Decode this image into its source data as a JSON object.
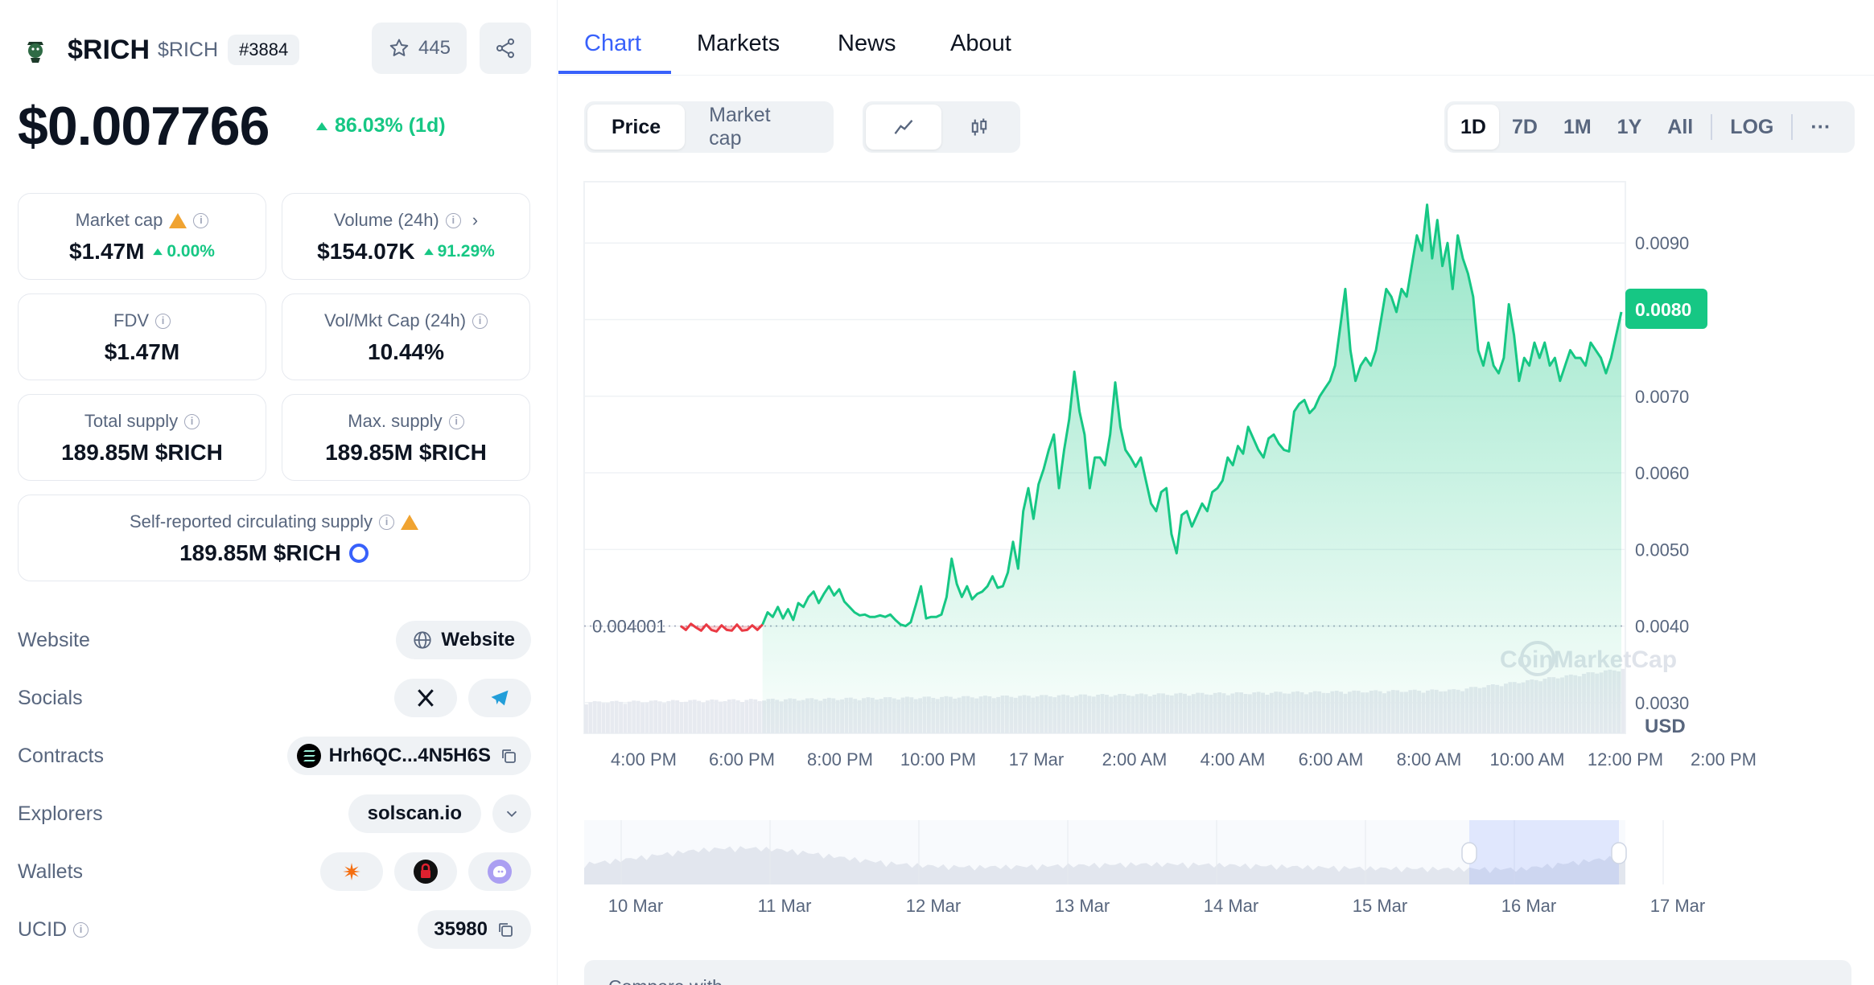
{
  "coin": {
    "name": "$RICH",
    "symbol": "$RICH",
    "rank": "#3884",
    "watchlist_count": "445",
    "price": "$0.007766",
    "change_1d": "86.03% (1d)"
  },
  "stats": {
    "market_cap": {
      "label": "Market cap",
      "value": "$1.47M",
      "change": "0.00%"
    },
    "volume": {
      "label": "Volume (24h)",
      "value": "$154.07K",
      "change": "91.29%"
    },
    "fdv": {
      "label": "FDV",
      "value": "$1.47M"
    },
    "vol_mkt": {
      "label": "Vol/Mkt Cap (24h)",
      "value": "10.44%"
    },
    "total_supply": {
      "label": "Total supply",
      "value": "189.85M $RICH"
    },
    "max_supply": {
      "label": "Max. supply",
      "value": "189.85M $RICH"
    },
    "circ_supply": {
      "label": "Self-reported circulating supply",
      "value": "189.85M $RICH"
    }
  },
  "links": {
    "website_label": "Website",
    "website_btn": "Website",
    "socials_label": "Socials",
    "contracts_label": "Contracts",
    "contract": "Hrh6QC...4N5H6S",
    "explorers_label": "Explorers",
    "explorer": "solscan.io",
    "wallets_label": "Wallets",
    "ucid_label": "UCID",
    "ucid": "35980"
  },
  "tabs": [
    "Chart",
    "Markets",
    "News",
    "About"
  ],
  "chart_toggle": {
    "price": "Price",
    "market_cap": "Market cap"
  },
  "ranges": [
    "1D",
    "7D",
    "1M",
    "1Y",
    "All",
    "LOG"
  ],
  "more_label": "···",
  "compare_label": "Compare with",
  "watermark": "CoinMarketCap",
  "colors": {
    "up": "#16c784",
    "down": "#ea3943",
    "accent": "#3861fb"
  },
  "chart_data": {
    "type": "line",
    "currency": "USD",
    "current_price_label": "0.0080",
    "open_price_label": "0.004001",
    "ylim": [
      0.0026,
      0.0098
    ],
    "y_ticks": [
      "0.0090",
      "0.0080",
      "0.0070",
      "0.0060",
      "0.0050",
      "0.0040",
      "0.0030"
    ],
    "y_tick_values": [
      0.009,
      0.008,
      0.007,
      0.006,
      0.005,
      0.004,
      0.003
    ],
    "x_ticks": [
      "4:00 PM",
      "6:00 PM",
      "8:00 PM",
      "10:00 PM",
      "17 Mar",
      "2:00 AM",
      "4:00 AM",
      "6:00 AM",
      "8:00 AM",
      "10:00 AM",
      "12:00 PM",
      "2:00 PM"
    ],
    "nav_ticks": [
      "10 Mar",
      "11 Mar",
      "12 Mar",
      "13 Mar",
      "14 Mar",
      "15 Mar",
      "16 Mar",
      "17 Mar"
    ],
    "series": [
      {
        "values": [
          0.004,
          0.00395,
          0.00403,
          0.00398,
          0.00394,
          0.00402,
          0.00395,
          0.00393,
          0.00401,
          0.00395,
          0.00394,
          0.00402,
          0.00394,
          0.00395,
          0.00401,
          0.00395,
          0.00402,
          0.00418,
          0.00412,
          0.00425,
          0.0041,
          0.00422,
          0.00408,
          0.0043,
          0.00425,
          0.00438,
          0.00445,
          0.0043,
          0.00442,
          0.00452,
          0.0044,
          0.00448,
          0.00432,
          0.00425,
          0.00418,
          0.00414,
          0.00415,
          0.00412,
          0.00412,
          0.00414,
          0.00412,
          0.00415,
          0.00408,
          0.00402,
          0.004,
          0.00405,
          0.00428,
          0.00452,
          0.0041,
          0.00412,
          0.00412,
          0.00415,
          0.00438,
          0.00488,
          0.00455,
          0.00438,
          0.00452,
          0.00435,
          0.00442,
          0.00445,
          0.00452,
          0.00465,
          0.0045,
          0.00452,
          0.0047,
          0.0051,
          0.00475,
          0.0055,
          0.0058,
          0.0054,
          0.00585,
          0.00605,
          0.0063,
          0.0065,
          0.0058,
          0.0063,
          0.0067,
          0.00732,
          0.0068,
          0.0065,
          0.0058,
          0.0062,
          0.0062,
          0.0061,
          0.0065,
          0.00718,
          0.0066,
          0.0063,
          0.0062,
          0.00608,
          0.0062,
          0.0059,
          0.0056,
          0.0055,
          0.00575,
          0.0058,
          0.0052,
          0.00495,
          0.00545,
          0.0055,
          0.0053,
          0.00545,
          0.0056,
          0.0055,
          0.00575,
          0.0058,
          0.0059,
          0.0062,
          0.0061,
          0.00635,
          0.00625,
          0.0066,
          0.00645,
          0.0063,
          0.0062,
          0.00645,
          0.0065,
          0.00638,
          0.0063,
          0.00628,
          0.0068,
          0.0069,
          0.00695,
          0.00678,
          0.00685,
          0.007,
          0.0071,
          0.0072,
          0.0074,
          0.0079,
          0.0084,
          0.0076,
          0.0072,
          0.0074,
          0.0075,
          0.0074,
          0.0076,
          0.008,
          0.0084,
          0.0083,
          0.0081,
          0.0084,
          0.0083,
          0.0087,
          0.0091,
          0.0089,
          0.0095,
          0.0088,
          0.0093,
          0.0087,
          0.009,
          0.0084,
          0.0091,
          0.0088,
          0.0086,
          0.0083,
          0.0076,
          0.0074,
          0.0077,
          0.0074,
          0.0073,
          0.0075,
          0.0082,
          0.0078,
          0.0072,
          0.0075,
          0.0074,
          0.0077,
          0.0075,
          0.0077,
          0.0074,
          0.0075,
          0.0072,
          0.0074,
          0.0076,
          0.0075,
          0.0075,
          0.0074,
          0.0077,
          0.0076,
          0.0075,
          0.0073,
          0.0075,
          0.0078,
          0.0081
        ]
      }
    ]
  }
}
